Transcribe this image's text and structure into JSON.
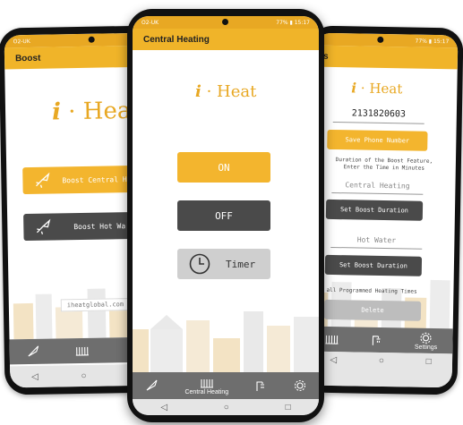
{
  "left_phone": {
    "status_left": "O2-UK",
    "appbar_title": "Boost",
    "logo_i": "i",
    "logo_dot": "·",
    "logo_word": "Heat",
    "boost_central_label": "Boost Central H",
    "boost_hot_label": "Boost Hot Wa",
    "website": "iheatglobal.com"
  },
  "center_phone": {
    "status_left": "O2-UK",
    "status_right": "77% ▮ 15:17",
    "appbar_title": "Central Heating",
    "logo_i": "i",
    "logo_dot": "·",
    "logo_word": "Heat",
    "on_label": "ON",
    "off_label": "OFF",
    "timer_label": "Timer",
    "nav_central_label": "Central Heating"
  },
  "right_phone": {
    "status_right": "77% ▮ 15:17",
    "appbar_title": "gs",
    "logo_i": "i",
    "logo_dot": "·",
    "logo_word": "Heat",
    "phone_number": "2131820603",
    "save_phone_label": "Save Phone Number",
    "duration_hint": "Duration of the Boost Feature, Enter the Time in Minutes",
    "central_placeholder": "Central Heating",
    "set_boost_label_1": "Set Boost Duration",
    "hot_water_placeholder": "Hot Water",
    "set_boost_label_2": "Set Boost Duration",
    "delete_hint": "lete all Programmed Heating Times",
    "delete_label": "Delete",
    "nav_settings_label": "Settings"
  },
  "colors": {
    "accent": "#f0b429",
    "dark_button": "#4a4a4a",
    "nav": "#6e6e6e"
  }
}
